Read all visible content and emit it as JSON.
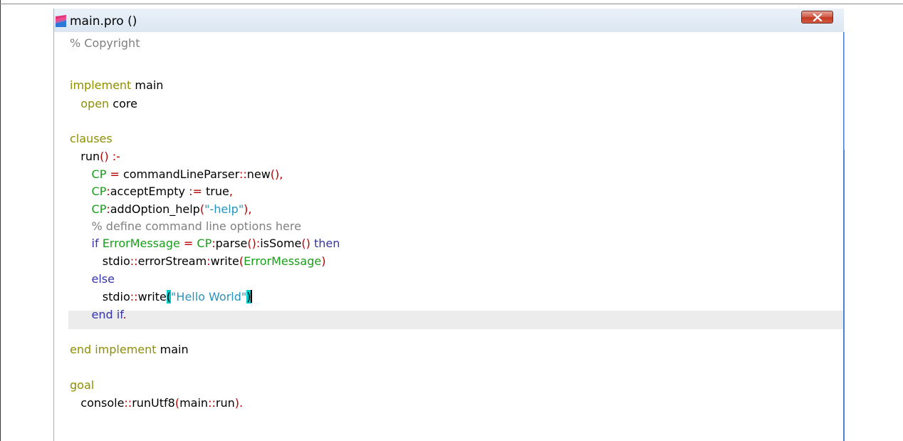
{
  "window": {
    "title": "main.pro ()",
    "close_glyph": "x"
  },
  "code": {
    "comment_copyright": "% Copyright",
    "kw_implement": "implement",
    "name_main": "main",
    "kw_open": "open",
    "name_core": "core",
    "kw_clauses": "clauses",
    "run_name": "run",
    "run_parens": "()",
    "run_op": ":-",
    "cp": "CP",
    "eq": "=",
    "cmdparser": "commandLineParser",
    "dcolon": "::",
    "new_fn": "new",
    "parens": "()",
    "comma": ",",
    "colon": ":",
    "accept_empty": "acceptEmpty",
    "assign": ":=",
    "true_val": "true",
    "add_option": "addOption_help",
    "lparen": "(",
    "rparen": ")",
    "help_str": "\"-help\"",
    "comment_define": "% define command line options here",
    "kw_if": "if",
    "error_message": "ErrorMessage",
    "parse_fn": "parse",
    "is_some": "isSome",
    "kw_then": "then",
    "stdio": "stdio",
    "error_stream": "errorStream",
    "write_fn": "write",
    "kw_else": "else",
    "hello_str": "\"Hello World\"",
    "kw_end_if": "end if",
    "dot": ".",
    "kw_end_implement": "end implement",
    "kw_goal": "goal",
    "console": "console",
    "run_utf8": "runUtf8",
    "main_run": "run"
  },
  "colors": {
    "keyword": "#8f8f00",
    "comment": "#808080",
    "operator": "#b40000",
    "variable": "#1c9c1c",
    "string": "#2a93bd",
    "control_keyword": "#3434a8",
    "bracket_match": "#00ccd0",
    "current_line": "#ececec"
  }
}
